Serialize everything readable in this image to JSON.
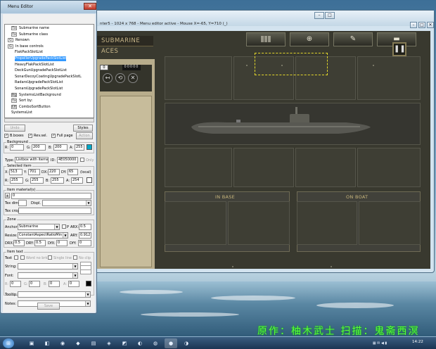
{
  "watermark": "原作：柚木武士 扫描：鬼斋西溟",
  "game_window": {
    "title": "nter5 - 1024 x 768 - Menu editor active - Mouse X=-65, Y=710 (_)",
    "banner": "SUBMARINE ACES",
    "counter": "0",
    "lcd": "00000",
    "tab_icons": [
      "crew-icon",
      "periscope-icon",
      "tools-icon",
      "torpedo-icon"
    ],
    "tab_glyphs": [
      "ǁǁǁ",
      "⊕",
      "✎",
      "▬"
    ],
    "left_icons": [
      "↤",
      "⟲",
      "✕"
    ],
    "in_base_label": "IN BASE",
    "on_boat_label": "ON BOAT"
  },
  "editor": {
    "title": "Menu Editor",
    "tree": [
      {
        "node": "Tx",
        "label": "Submarine name",
        "indent": 1
      },
      {
        "node": "Tx",
        "label": "Submarine class",
        "indent": 1
      },
      {
        "node": "G",
        "label": "Renown",
        "indent": 0
      },
      {
        "node": "G",
        "label": "In base controls",
        "indent": 0
      },
      {
        "node": "",
        "label": "FlakPackSlotList",
        "indent": 2
      },
      {
        "node": "",
        "label": "PropellerUpgradePackSlotList",
        "indent": 2,
        "selected": true
      },
      {
        "node": "",
        "label": "HeavyFlakPackSlotList",
        "indent": 2
      },
      {
        "node": "",
        "label": "DeckGunUpgradePackSlotList",
        "indent": 2
      },
      {
        "node": "",
        "label": "SonarDecoyCoatingUpgradePackSlotL",
        "indent": 2
      },
      {
        "node": "",
        "label": "RadarsUpgradePackSlotList",
        "indent": 2
      },
      {
        "node": "",
        "label": "SonarsUpgradePackSlotList",
        "indent": 2
      },
      {
        "node": "Bg",
        "label": "SystemsListBackground",
        "indent": 1
      },
      {
        "node": "Tx",
        "label": "Sort by:",
        "indent": 1
      },
      {
        "node": "Elt",
        "label": "ComboSortButton",
        "indent": 1
      },
      {
        "node": "",
        "label": "SystemsList",
        "indent": 1
      }
    ],
    "undo_label": "Undo",
    "styles_label": "Styles",
    "checks": {
      "b_boxes": "B.boxes",
      "rev_sel": "Rev.sel.",
      "full_page": "Full page",
      "action": "Action"
    },
    "background": {
      "title": "Background",
      "r": "0",
      "g": "200",
      "b": "200",
      "a": "255",
      "color": "#00a8c8"
    },
    "type": {
      "label": "Type:",
      "value": "Listbox with items",
      "id_label": "ID:",
      "id_value": "4E050000",
      "only": "Only"
    },
    "selected_item": {
      "title": "Selected item",
      "x": "513",
      "y": "701",
      "dx": "220",
      "dy": "65",
      "local": "(local)",
      "r": "255",
      "g": "255",
      "b": "255",
      "a": "254"
    },
    "item_material": {
      "title": "Item material(s)",
      "value": "0",
      "tex_dim": "Tex dim.",
      "displ": "Displ.",
      "tex_crop": "Tex crop"
    },
    "zone": {
      "title": "Zone",
      "anchor_label": "Anchor:",
      "anchor_value": "Submarine",
      "p_label": "P",
      "arx_label": "ARX:",
      "arx_value": "0.5",
      "resize_label": "Resize:",
      "resize_value": "ConstantAspectRatioMin",
      "ary_label": "ARY:",
      "ary_value": "0.912",
      "drx_label": "DRX:",
      "drx_value": "0.5",
      "dry_label": "DRY:",
      "dry_value": "0.5",
      "dfx_label": "DfX:",
      "dfx_value": "0",
      "dfy_label": "DfY:",
      "dfy_value": "0"
    },
    "item_text": {
      "title": "Item text",
      "text_label": "Text",
      "word_no_brk": "Word no brk",
      "single_line": "Single line",
      "no_clip": "No clip",
      "string_label": "String:",
      "font_label": "Font:",
      "r": "0",
      "g": "0",
      "b": "0",
      "a": "0",
      "tooltip_label": "Tooltip:",
      "notes_label": "Notes:"
    },
    "save_label": "Save"
  },
  "taskbar": {
    "time": "14:22"
  }
}
